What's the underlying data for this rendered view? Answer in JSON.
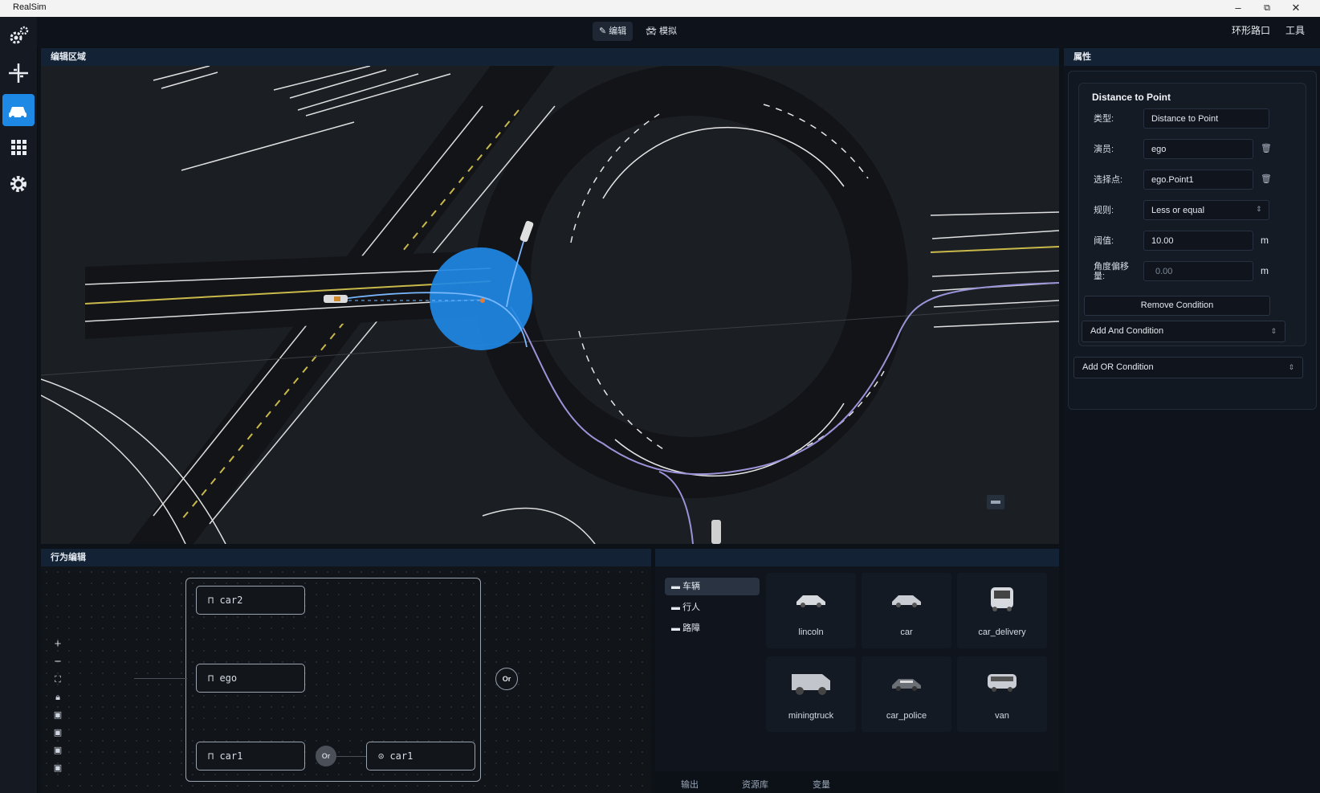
{
  "window": {
    "title": "RealSim",
    "controls": [
      "–",
      "⧉",
      "✕"
    ]
  },
  "topbar": {
    "edit_label": "编辑",
    "simulate_label": "模拟",
    "scene_label": "环形路口",
    "tools_label": "工具"
  },
  "sidebar": {
    "icons": [
      "settings-cogs-icon",
      "road-icon",
      "vehicles-icon",
      "grid-apps-icon",
      "gear-icon"
    ],
    "active_index": 2,
    "accent": "#1e88e5"
  },
  "editor": {
    "title": "编辑区域",
    "trigger_circle_color": "#1e88e5",
    "path_color": "#9b93d8"
  },
  "properties": {
    "title": "属性",
    "condition_title": "Distance to Point",
    "fields": [
      {
        "label": "类型:",
        "value": "Distance to Point",
        "unit": ""
      },
      {
        "label": "演员:",
        "value": "ego",
        "unit": ""
      },
      {
        "label": "选择点:",
        "value": "ego.Point1",
        "unit": ""
      },
      {
        "label": "规则:",
        "value": "Less or equal",
        "unit": ""
      },
      {
        "label": "阈值:",
        "value": "10.00",
        "unit": "m"
      },
      {
        "label": "角度偏移量:",
        "value": "0.00",
        "unit": "m"
      }
    ],
    "remove_label": "Remove Condition",
    "add_and_label": "Add And Condition",
    "add_or_label": "Add OR Condition"
  },
  "behavior": {
    "title": "行为编辑",
    "nodes": [
      "car2",
      "ego",
      "car1",
      "car1"
    ],
    "or_label": "Or"
  },
  "library": {
    "folders": [
      "车辆",
      "行人",
      "路障"
    ],
    "active_folder": 0,
    "assets": [
      "lincoln",
      "car",
      "car_delivery",
      "miningtruck",
      "car_police",
      "van"
    ],
    "tabs": [
      "输出",
      "资源库",
      "变量"
    ]
  }
}
